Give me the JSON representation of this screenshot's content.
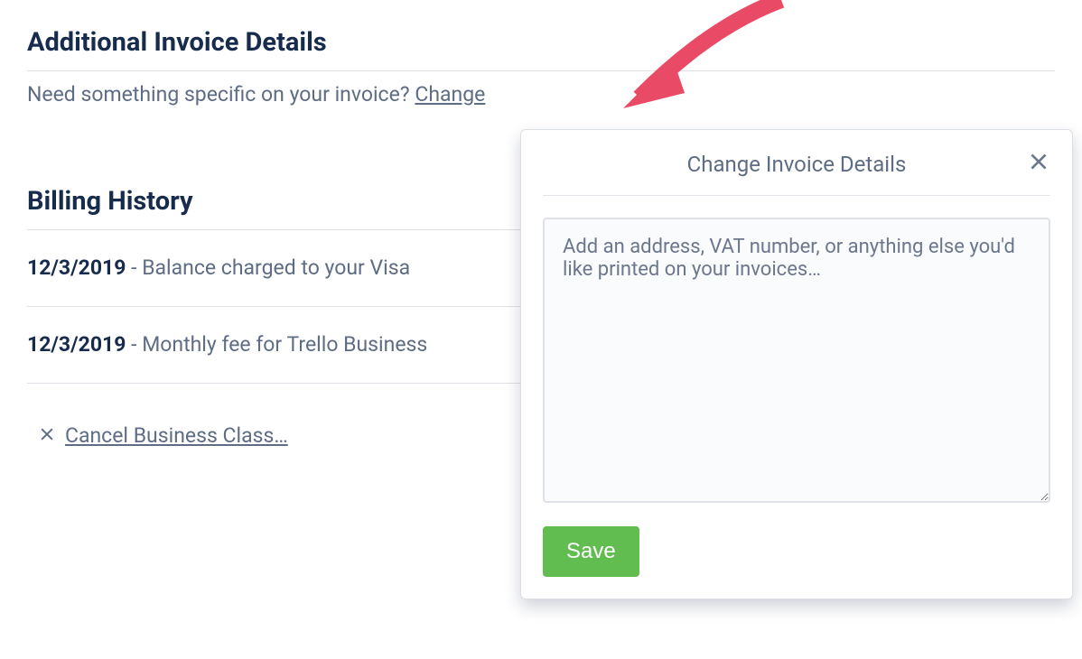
{
  "invoice_section": {
    "heading": "Additional Invoice Details",
    "prompt_text": "Need something specific on your invoice? ",
    "change_link": "Change"
  },
  "billing_section": {
    "heading": "Billing History",
    "items": [
      {
        "date": "12/3/2019",
        "description": " - Balance charged to your Visa"
      },
      {
        "date": "12/3/2019",
        "description": " - Monthly fee for Trello Business"
      }
    ]
  },
  "cancel": {
    "label": "Cancel Business Class…"
  },
  "popover": {
    "title": "Change Invoice Details",
    "textarea_placeholder": "Add an address, VAT number, or anything else you'd like printed on your invoices…",
    "save_label": "Save"
  }
}
